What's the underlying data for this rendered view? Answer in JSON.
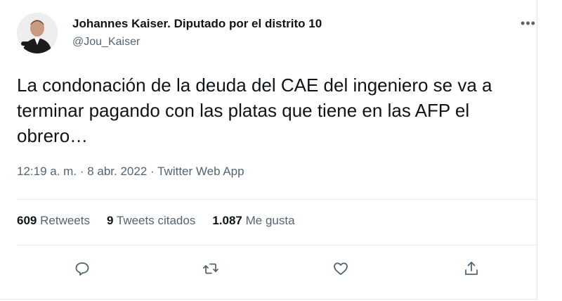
{
  "author": {
    "name": "Johannes Kaiser. Diputado por el distrito 10",
    "handle": "@Jou_Kaiser"
  },
  "tweet": {
    "text": "La condonación de la deuda del CAE del ingeniero se va a terminar pagando con las platas que tiene en las AFP el obrero…",
    "time": "12:19 a. m.",
    "sep1": "·",
    "date": "8 abr. 2022",
    "sep2": "·",
    "source": "Twitter Web App"
  },
  "stats": {
    "retweets_count": "609",
    "retweets_label": "Retweets",
    "quotes_count": "9",
    "quotes_label": "Tweets citados",
    "likes_count": "1.087",
    "likes_label": "Me gusta"
  },
  "icons": {
    "more": "more-icon",
    "reply": "reply-icon",
    "retweet": "retweet-icon",
    "like": "heart-icon",
    "share": "share-icon"
  }
}
